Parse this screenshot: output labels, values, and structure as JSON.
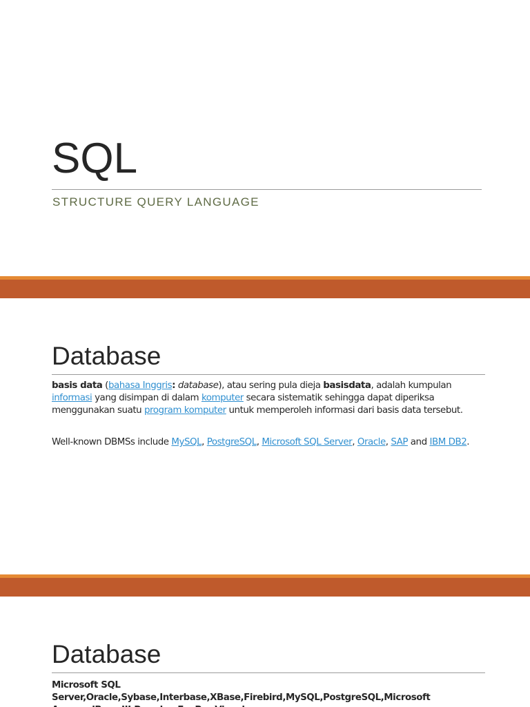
{
  "slide1": {
    "title": "SQL",
    "subtitle": "STRUCTURE QUERY LANGUAGE"
  },
  "slide2": {
    "title": "Database",
    "para1": {
      "term": "basis data",
      "open_paren": " (",
      "link_language": "bahasa Inggris",
      "colon": ":",
      "space": " ",
      "english_term": "database",
      "text_after_term": "), atau sering pula dieja ",
      "term2": "basisdata",
      "text_a": ", adalah kumpulan ",
      "link_informasi": "informasi",
      "text_b": " yang disimpan di dalam ",
      "link_komputer": "komputer",
      "text_c": " secara sistematik sehingga dapat diperiksa menggunakan suatu ",
      "link_program": "program komputer",
      "text_d": " untuk memperoleh informasi dari basis data tersebut."
    },
    "para2": {
      "intro": "Well-known DBMSs include ",
      "link_mysql": "MySQL",
      "sep1": ", ",
      "link_postgres": "PostgreSQL",
      "sep2": ", ",
      "link_mssql": "Microsoft SQL Server",
      "sep3": ", ",
      "link_oracle": "Oracle",
      "sep4": ", ",
      "link_sap": "SAP",
      "and": " and ",
      "link_db2": "IBM DB2",
      "end": "."
    }
  },
  "slide3": {
    "title": "Database",
    "body": "Microsoft SQL Server,Oracle,Sybase,Interbase,XBase,Firebird,MySQL,PostgreSQL,Microsoft Access,dBase III,Paradox,FoxPro,Visual FoxPro,Arago,Force,Recital,dbFast,dbXL,Quicksilver,Clipper,FlagShip,Harbour,Visual"
  },
  "colors": {
    "separator": "#bf5a2c",
    "separator_highlight": "#e58a34",
    "subtitle": "#5f6b45",
    "link": "#2f8fd0"
  }
}
